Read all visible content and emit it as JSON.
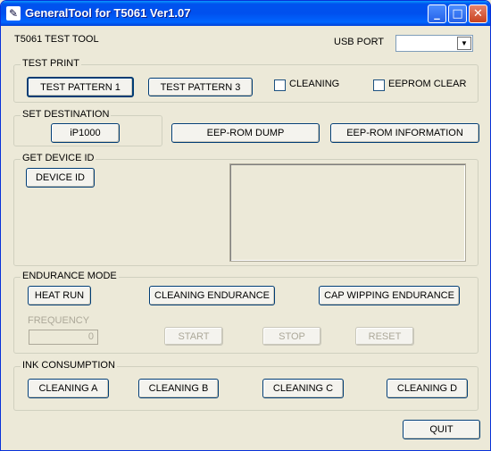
{
  "window": {
    "title": "GeneralTool for T5061 Ver1.07",
    "app_icon": "generaltool-icon"
  },
  "titlebar": {
    "minimize": "_",
    "maximize": "□",
    "close": "✕"
  },
  "header": {
    "tool_name": "T5061 TEST TOOL",
    "usb_port_label": "USB PORT",
    "usb_port_value": ""
  },
  "test_print": {
    "legend": "TEST PRINT",
    "pattern1": "TEST PATTERN 1",
    "pattern3": "TEST PATTERN 3",
    "cleaning": "CLEANING",
    "eeprom_clear": "EEPROM CLEAR"
  },
  "set_destination": {
    "legend": "SET DESTINATION",
    "button": "iP1000"
  },
  "eeprom": {
    "dump": "EEP-ROM DUMP",
    "information": "EEP-ROM INFORMATION"
  },
  "device_id": {
    "legend": "GET DEVICE ID",
    "button": "DEVICE ID"
  },
  "endurance": {
    "legend": "ENDURANCE MODE",
    "heat_run": "HEAT RUN",
    "cleaning_endurance": "CLEANING ENDURANCE",
    "cap_wipping": "CAP WIPPING ENDURANCE",
    "frequency_label": "FREQUENCY",
    "frequency_value": "0",
    "start": "START",
    "stop": "STOP",
    "reset": "RESET"
  },
  "ink": {
    "legend": "INK CONSUMPTION",
    "a": "CLEANING A",
    "b": "CLEANING B",
    "c": "CLEANING C",
    "d": "CLEANING D"
  },
  "quit": "QUIT"
}
